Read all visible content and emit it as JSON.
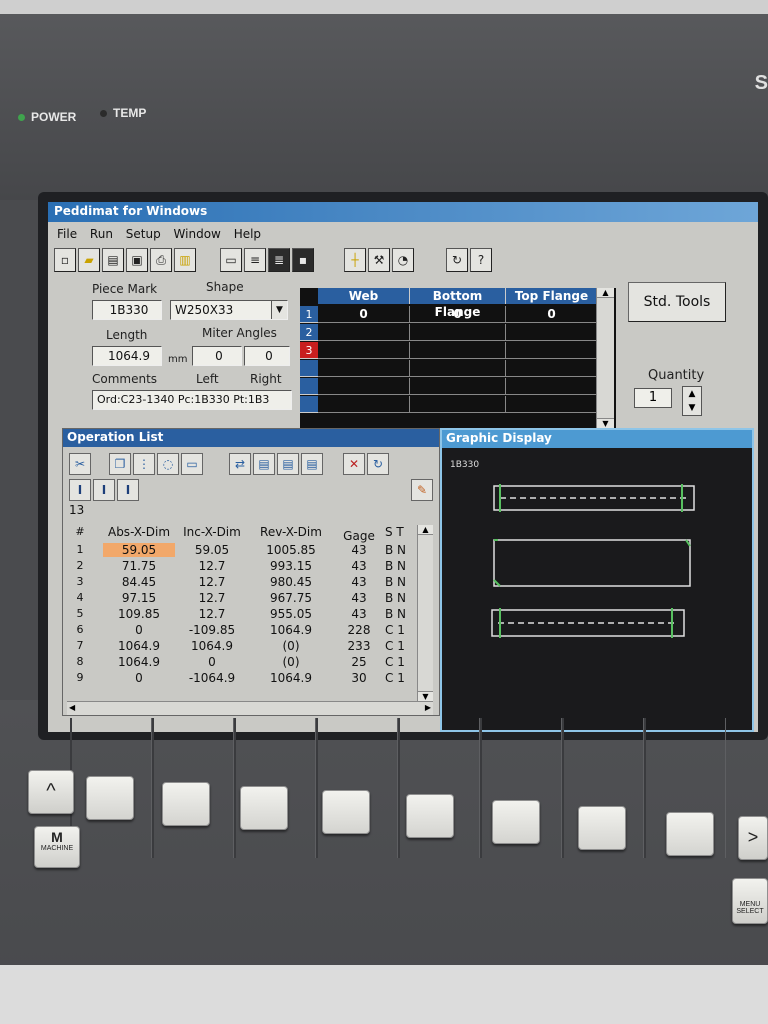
{
  "bezel": {
    "power_label": "POWER",
    "temp_label": "TEMP",
    "right_edge_letter": "S",
    "machine_label": "MACHINE",
    "menu_select_label": "MENU SELECT"
  },
  "app": {
    "title": "Peddimat for Windows",
    "menu": [
      "File",
      "Run",
      "Setup",
      "Window",
      "Help"
    ]
  },
  "piece": {
    "piece_mark_label": "Piece Mark",
    "piece_mark": "1B330",
    "shape_label": "Shape",
    "shape": "W250X33",
    "length_label": "Length",
    "length": "1064.9",
    "length_unit": "mm",
    "miter_label": "Miter Angles",
    "miter_left": "0",
    "miter_right": "0",
    "comments_label": "Comments",
    "left_label": "Left",
    "right_label": "Right",
    "comments": "Ord:C23-1340 Pc:1B330 Pt:1B3"
  },
  "flange_grid": {
    "headers": [
      "Web",
      "Bottom Flange",
      "Top Flange"
    ],
    "rows": [
      {
        "num": "1",
        "values": [
          "0",
          "0",
          "0"
        ]
      },
      {
        "num": "2",
        "values": [
          "",
          "",
          ""
        ]
      },
      {
        "num": "3",
        "values": [
          "",
          "",
          ""
        ]
      },
      {
        "num": "",
        "values": [
          "",
          "",
          ""
        ]
      },
      {
        "num": "",
        "values": [
          "",
          "",
          ""
        ]
      },
      {
        "num": "",
        "values": [
          "",
          "",
          ""
        ]
      }
    ]
  },
  "std_tools_label": "Std. Tools",
  "quantity_label": "Quantity",
  "quantity": "1",
  "operation_list": {
    "title": "Operation List",
    "count": "13",
    "headers": {
      "idx": "#",
      "abs": "Abs-X-Dim",
      "inc": "Inc-X-Dim",
      "rev": "Rev-X-Dim",
      "gage": "Gage",
      "s": "S T"
    },
    "rows": [
      {
        "idx": "1",
        "abs": "59.05",
        "inc": "59.05",
        "rev": "1005.85",
        "gage": "43",
        "s": "B N"
      },
      {
        "idx": "2",
        "abs": "71.75",
        "inc": "12.7",
        "rev": "993.15",
        "gage": "43",
        "s": "B N"
      },
      {
        "idx": "3",
        "abs": "84.45",
        "inc": "12.7",
        "rev": "980.45",
        "gage": "43",
        "s": "B N"
      },
      {
        "idx": "4",
        "abs": "97.15",
        "inc": "12.7",
        "rev": "967.75",
        "gage": "43",
        "s": "B N"
      },
      {
        "idx": "5",
        "abs": "109.85",
        "inc": "12.7",
        "rev": "955.05",
        "gage": "43",
        "s": "B N"
      },
      {
        "idx": "6",
        "abs": "0",
        "inc": "-109.85",
        "rev": "1064.9",
        "gage": "228",
        "s": "C 1"
      },
      {
        "idx": "7",
        "abs": "1064.9",
        "inc": "1064.9",
        "rev": "(0)",
        "gage": "233",
        "s": "C 1"
      },
      {
        "idx": "8",
        "abs": "1064.9",
        "inc": "0",
        "rev": "(0)",
        "gage": "25",
        "s": "C 1"
      },
      {
        "idx": "9",
        "abs": "0",
        "inc": "-1064.9",
        "rev": "1064.9",
        "gage": "30",
        "s": "C 1"
      }
    ]
  },
  "graphic_display": {
    "title": "Graphic Display",
    "piece_label": "1B330"
  }
}
